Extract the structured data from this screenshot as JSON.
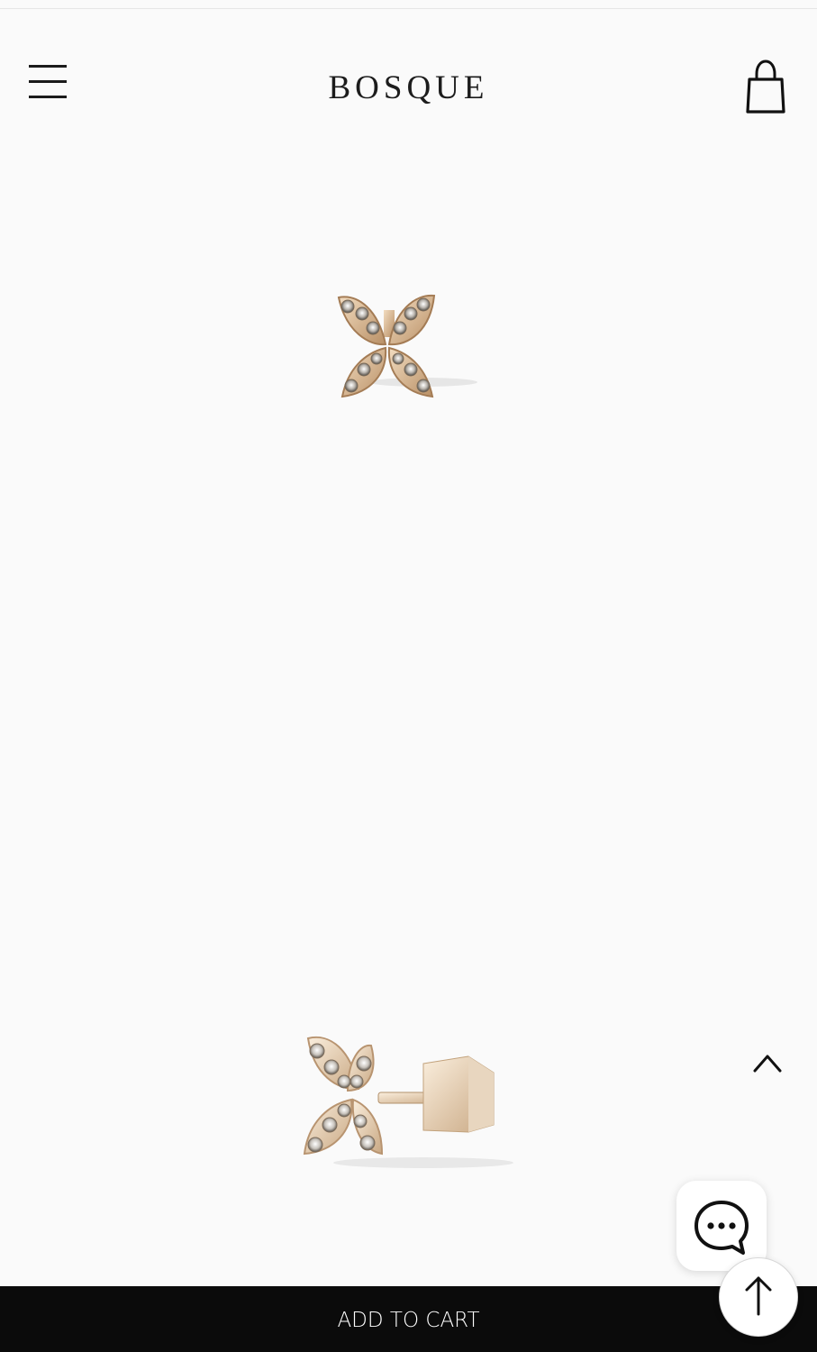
{
  "header": {
    "brand": "BOSQUE",
    "menu_icon": "hamburger-menu-icon",
    "cart_icon": "shopping-bag-icon"
  },
  "gallery": {
    "images": [
      {
        "alt": "butterfly-stud-earring-front-view"
      },
      {
        "alt": "butterfly-stud-earring-side-view"
      }
    ]
  },
  "floating": {
    "scroll_up_icon": "chevron-up-icon",
    "chat_icon": "chat-bubble-icon",
    "back_to_top_icon": "arrow-up-icon"
  },
  "footer": {
    "add_to_cart_label": "ADD TO CART"
  },
  "colors": {
    "background": "#fafafa",
    "bar": "#0b0b0b",
    "gold": "#d9b98f"
  }
}
